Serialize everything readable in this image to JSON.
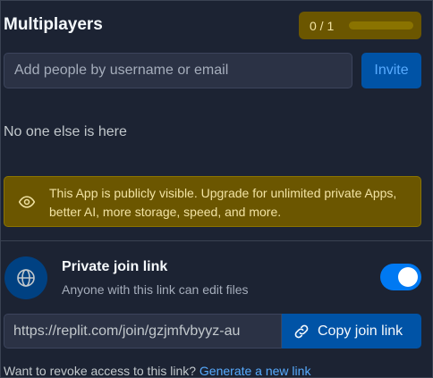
{
  "header": {
    "title": "Multiplayers",
    "count": "0 / 1"
  },
  "invite": {
    "placeholder": "Add people by username or email",
    "button_label": "Invite"
  },
  "empty_state": "No one else is here",
  "notice": {
    "icon": "eye-icon",
    "text": "This App is publicly visible. Upgrade for unlimited private Apps, better AI, more storage, speed, and more."
  },
  "join_link": {
    "icon": "globe-icon",
    "title": "Private join link",
    "subtitle": "Anyone with this link can edit files",
    "enabled": true,
    "url": "https://replit.com/join/gzjmfvbyyz-au",
    "copy_label": "Copy join link",
    "copy_icon": "link-icon"
  },
  "revoke": {
    "text": "Want to revoke access to this link?",
    "link_label": "Generate a new link"
  },
  "colors": {
    "background": "#1c2333",
    "accent_blue": "#0079f2",
    "warning_bg": "#6b5600",
    "warning_text": "#f2e3a3",
    "link_text": "#57abff"
  }
}
